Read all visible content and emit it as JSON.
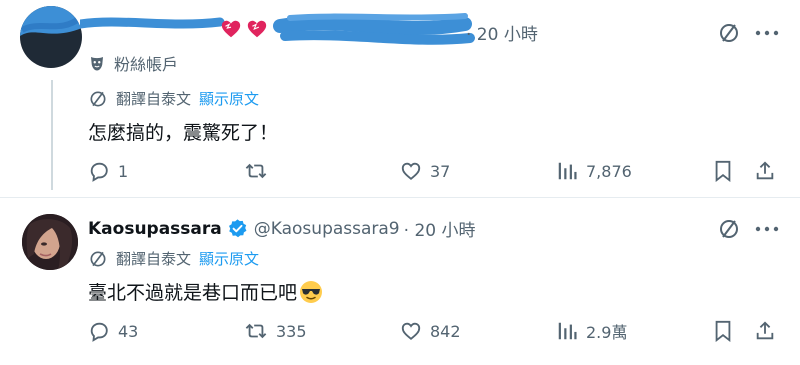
{
  "tweet1": {
    "time": "· 20 小時",
    "badge_label": "粉絲帳戶",
    "translate_label": "翻譯自泰文",
    "show_original": "顯示原文",
    "text": "怎麼搞的，震驚死了！",
    "replies": "1",
    "likes": "37",
    "views": "7,876"
  },
  "tweet2": {
    "display_name": "Kaosupassara",
    "handle": "@Kaosupassara9",
    "time": "· 20 小時",
    "translate_label": "翻譯自泰文",
    "show_original": "顯示原文",
    "text": "臺北不過就是巷口而已吧",
    "replies": "43",
    "retweets": "335",
    "likes": "842",
    "views": "2.9萬"
  },
  "icons": [
    "translate-icon",
    "more-icon",
    "comedy-mask-icon",
    "reply-icon",
    "retweet-icon",
    "like-icon",
    "views-icon",
    "bookmark-icon",
    "share-icon",
    "verified-badge-icon",
    "sunglasses-emoji-icon",
    "heart-emoji-icon"
  ],
  "colors": {
    "accent": "#1d9bf0",
    "muted": "#536471",
    "text": "#0f1419",
    "redaction": "#3d8fd6"
  }
}
